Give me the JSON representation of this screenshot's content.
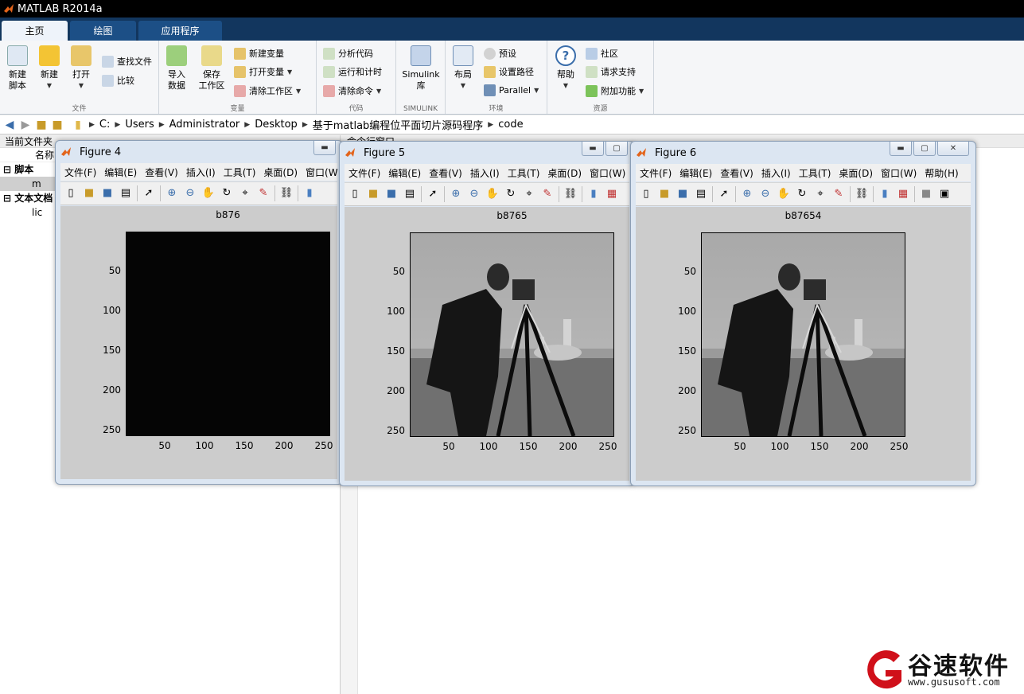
{
  "app": {
    "title": "MATLAB R2014a"
  },
  "tabs": [
    {
      "label": "主页"
    },
    {
      "label": "绘图"
    },
    {
      "label": "应用程序"
    }
  ],
  "ribbon": {
    "file": {
      "label": "文件",
      "new_script": "新建\n脚本",
      "new": "新建",
      "open": "打开",
      "find_files": "查找文件",
      "compare": "比较"
    },
    "variable": {
      "label": "变量",
      "import": "导入\n数据",
      "save_ws": "保存\n工作区",
      "new_var": "新建变量",
      "open_var": "打开变量",
      "clear_ws": "清除工作区"
    },
    "code": {
      "label": "代码",
      "analyze": "分析代码",
      "run_time": "运行和计时",
      "clear_cmd": "清除命令"
    },
    "simulink": {
      "label": "SIMULINK",
      "lib": "Simulink\n库"
    },
    "env": {
      "label": "环境",
      "layout": "布局",
      "prefs": "预设",
      "set_path": "设置路径",
      "parallel": "Parallel"
    },
    "resources": {
      "label": "资源",
      "help": "帮助",
      "community": "社区",
      "request_support": "请求支持",
      "addons": "附加功能"
    }
  },
  "address": {
    "parts": [
      "C:",
      "Users",
      "Administrator",
      "Desktop",
      "基于matlab编程位平面切片源码程序",
      "code"
    ]
  },
  "left_panel": {
    "header": "当前文件夹",
    "column": "名称",
    "groups": [
      {
        "label": "脚本",
        "items": [
          "m"
        ]
      },
      {
        "label": "文本文档",
        "items": [
          "lic"
        ]
      }
    ]
  },
  "right_panel": {
    "header": "命令行窗口"
  },
  "figures": [
    {
      "title": "Figure 4",
      "axes_title": "b876",
      "image": "dark",
      "menu": [
        "文件(F)",
        "编辑(E)",
        "查看(V)",
        "插入(I)",
        "工具(T)",
        "桌面(D)",
        "窗口(W)"
      ]
    },
    {
      "title": "Figure 5",
      "axes_title": "b8765",
      "image": "cameraman",
      "menu": [
        "文件(F)",
        "编辑(E)",
        "查看(V)",
        "插入(I)",
        "工具(T)",
        "桌面(D)",
        "窗口(W)"
      ]
    },
    {
      "title": "Figure 6",
      "axes_title": "b87654",
      "image": "cameraman",
      "menu": [
        "文件(F)",
        "编辑(E)",
        "查看(V)",
        "插入(I)",
        "工具(T)",
        "桌面(D)",
        "窗口(W)",
        "帮助(H)"
      ]
    }
  ],
  "axes_ticks": {
    "y": [
      "50",
      "100",
      "150",
      "200",
      "250"
    ],
    "x": [
      "50",
      "100",
      "150",
      "200",
      "250"
    ]
  },
  "watermark": {
    "brand": "谷速软件",
    "url": "www.gususoft.com"
  },
  "colors": {
    "accent": "#12365e",
    "brand_red": "#d0101a"
  }
}
